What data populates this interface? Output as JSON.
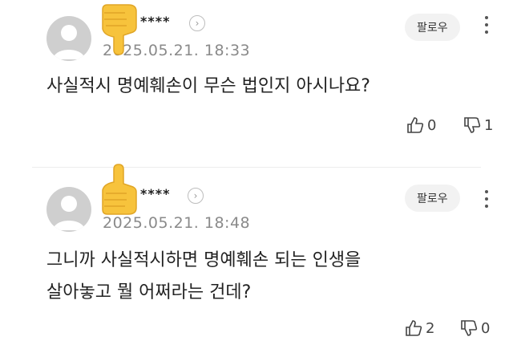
{
  "comments": [
    {
      "username": "****",
      "date": "2025.05.21. 18:33",
      "follow_label": "팔로우",
      "text_lines": [
        "사실적시 명예훼손이 무슨 법인지 아시나요?"
      ],
      "likes": "0",
      "dislikes": "1",
      "reaction_emoji": "thumbs-down"
    },
    {
      "username": "****",
      "date": "2025.05.21. 18:48",
      "follow_label": "팔로우",
      "text_lines": [
        "그니까 사실적시하면 명예훼손 되는 인생을",
        "살아놓고 뭘 어쩌라는 건데?"
      ],
      "likes": "2",
      "dislikes": "0",
      "reaction_emoji": "thumbs-up"
    }
  ],
  "icons": {
    "avatar": "default-user-avatar-icon",
    "chevron": "chevron-right-icon",
    "more": "vertical-ellipsis-icon",
    "like": "thumbs-up-outline-icon",
    "dislike": "thumbs-down-outline-icon"
  },
  "colors": {
    "emoji_yellow": "#f7c33c",
    "date_gray": "#8a8a8a",
    "follow_bg": "#f2f2f2"
  }
}
